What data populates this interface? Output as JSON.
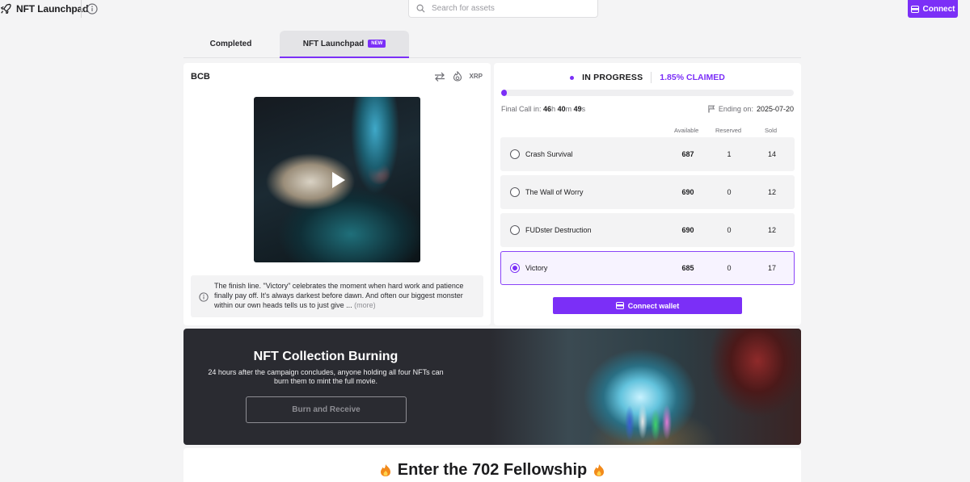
{
  "app": {
    "title": "NFT Launchpad",
    "search_placeholder": "Search for assets",
    "connect_label": "Connect"
  },
  "tabs": [
    {
      "label": "Completed",
      "active": false
    },
    {
      "label": "NFT Launchpad",
      "badge": "NEW",
      "active": true
    }
  ],
  "collection": {
    "name": "BCB",
    "network": "XRP",
    "description": "The finish line. \"Victory\" celebrates the moment when hard work and patience finally pay off. It's always darkest before dawn. And often our biggest monster within our own heads tells us to just give ...",
    "more_label": "(more)"
  },
  "sale": {
    "status": "IN PROGRESS",
    "claimed": "1.85% CLAIMED",
    "progress_fraction": 0.0185,
    "final_call_label": "Final Call in:",
    "countdown": {
      "h": "46",
      "m": "40",
      "s": "49"
    },
    "ending_label": "Ending on:",
    "ending_date": "2025-07-20",
    "columns": {
      "available": "Available",
      "reserved": "Reserved",
      "sold": "Sold"
    },
    "options": [
      {
        "name": "Crash Survival",
        "available": "687",
        "reserved": "1",
        "sold": "14",
        "selected": false
      },
      {
        "name": "The Wall of Worry",
        "available": "690",
        "reserved": "0",
        "sold": "12",
        "selected": false
      },
      {
        "name": "FUDster Destruction",
        "available": "690",
        "reserved": "0",
        "sold": "12",
        "selected": false
      },
      {
        "name": "Victory",
        "available": "685",
        "reserved": "0",
        "sold": "17",
        "selected": true
      }
    ],
    "connect_wallet_label": "Connect wallet"
  },
  "burn": {
    "title": "NFT Collection Burning",
    "subtitle": "24 hours after the campaign concludes, anyone holding all four NFTs can burn them to mint the full movie.",
    "button_label": "Burn and Receive"
  },
  "fellowship": {
    "title": "Enter the 702 Fellowship"
  },
  "colors": {
    "accent": "#7b2ff7",
    "banner_bg": "#2a2b31"
  },
  "icons": [
    "rocket-icon",
    "info-icon",
    "search-icon",
    "wallet-icon",
    "swap-icon",
    "flame-icon",
    "play-icon",
    "flag-icon"
  ]
}
